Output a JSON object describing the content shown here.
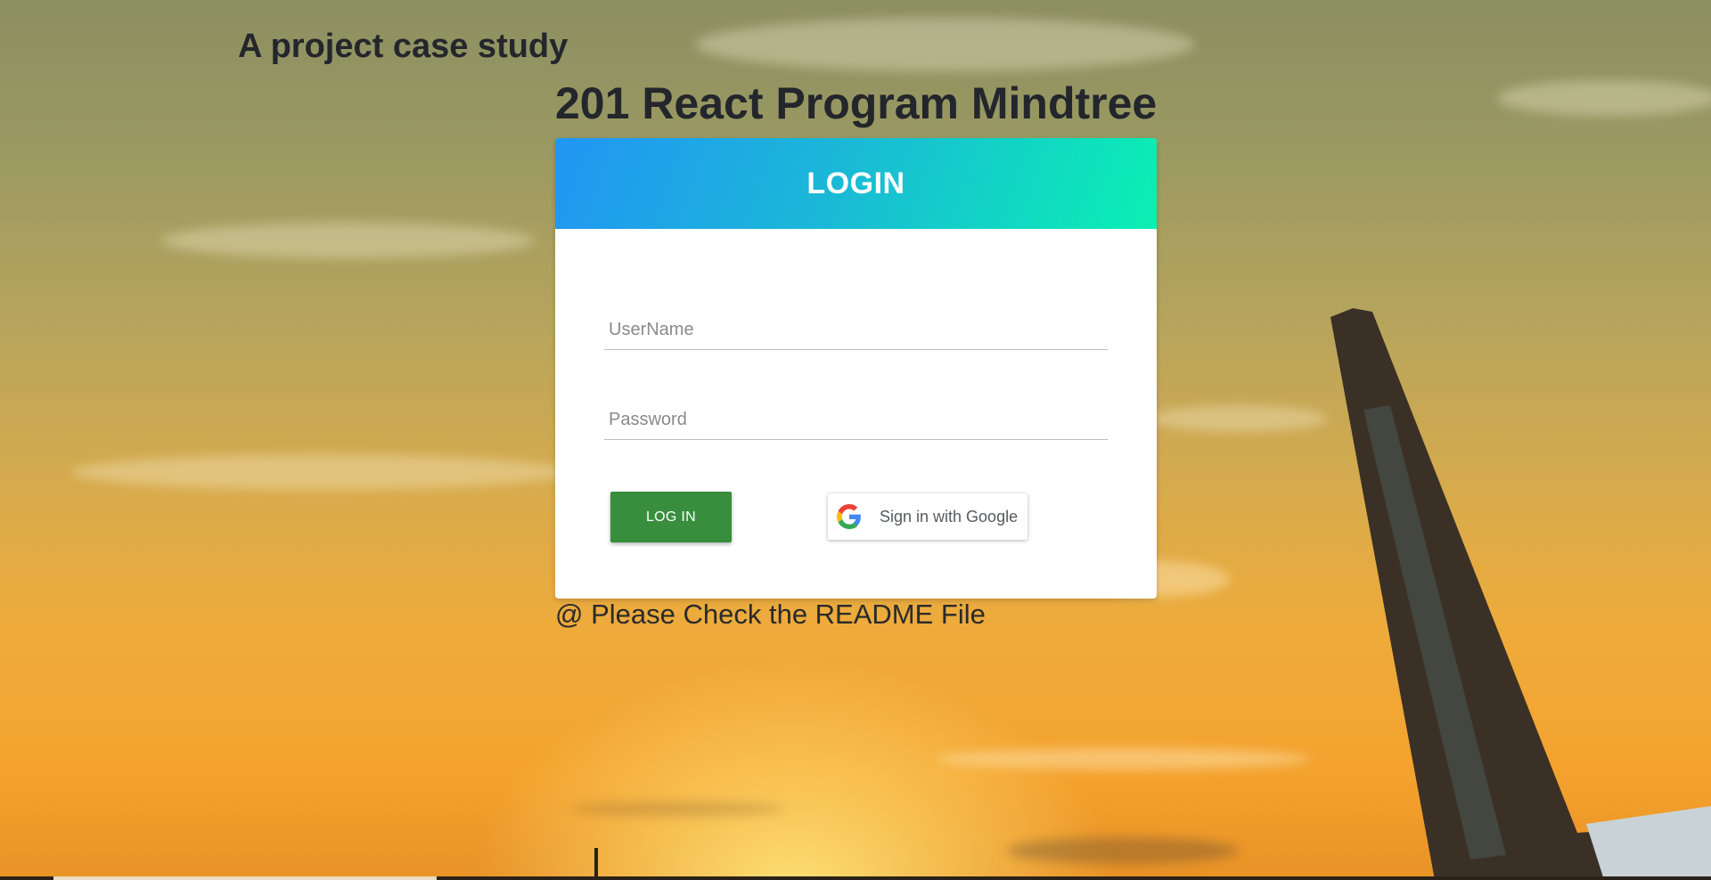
{
  "page": {
    "subtitle": "A project case study",
    "heading": "201 React Program Mindtree",
    "note": "@ Please Check the README File"
  },
  "login_card": {
    "title": "LOGIN",
    "username": {
      "placeholder": "UserName",
      "value": ""
    },
    "password": {
      "placeholder": "Password",
      "value": ""
    },
    "login_button_label": "LOG IN",
    "google_button_label": "Sign in with Google",
    "google_icon": "google-g-icon"
  },
  "colors": {
    "header_gradient_start": "#2196f3",
    "header_gradient_end": "#0af0b3",
    "login_button": "#388e3c",
    "background_top": "#8c8f62",
    "background_bottom": "#e89226"
  },
  "background": {
    "description_icon": "sunset-airplane-tail-image"
  }
}
